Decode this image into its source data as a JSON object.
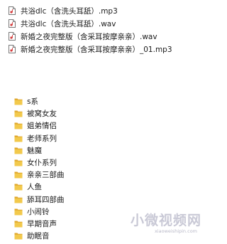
{
  "files": [
    {
      "name": "共浴dlc（含洗头耳舐）.mp3",
      "icon": "audio-file-icon"
    },
    {
      "name": "共浴dlc（含洗头耳舐）.wav",
      "icon": "audio-file-icon"
    },
    {
      "name": "新婚之夜完整版（含采耳按摩亲亲）.wav",
      "icon": "audio-file-icon"
    },
    {
      "name": "新婚之夜完整版（含采耳按摩亲亲）_01.mp3",
      "icon": "audio-file-icon"
    }
  ],
  "folders": [
    {
      "name": "s系"
    },
    {
      "name": "被窝女友"
    },
    {
      "name": "姐弟情侣"
    },
    {
      "name": "老师系列"
    },
    {
      "name": "魅魔"
    },
    {
      "name": "女仆系列"
    },
    {
      "name": "亲亲三部曲"
    },
    {
      "name": "人鱼"
    },
    {
      "name": "舔耳四部曲"
    },
    {
      "name": "小闹铃"
    },
    {
      "name": "早期音声"
    },
    {
      "name": "助眠音"
    }
  ],
  "watermark": {
    "text": "小微视频网",
    "url": "xiaoweishipin.com"
  },
  "colors": {
    "folder": "#f2c94c",
    "folder_dark": "#e0a82e",
    "file_icon_accent": "#d33a3a",
    "watermark": "#c9c9d6"
  }
}
